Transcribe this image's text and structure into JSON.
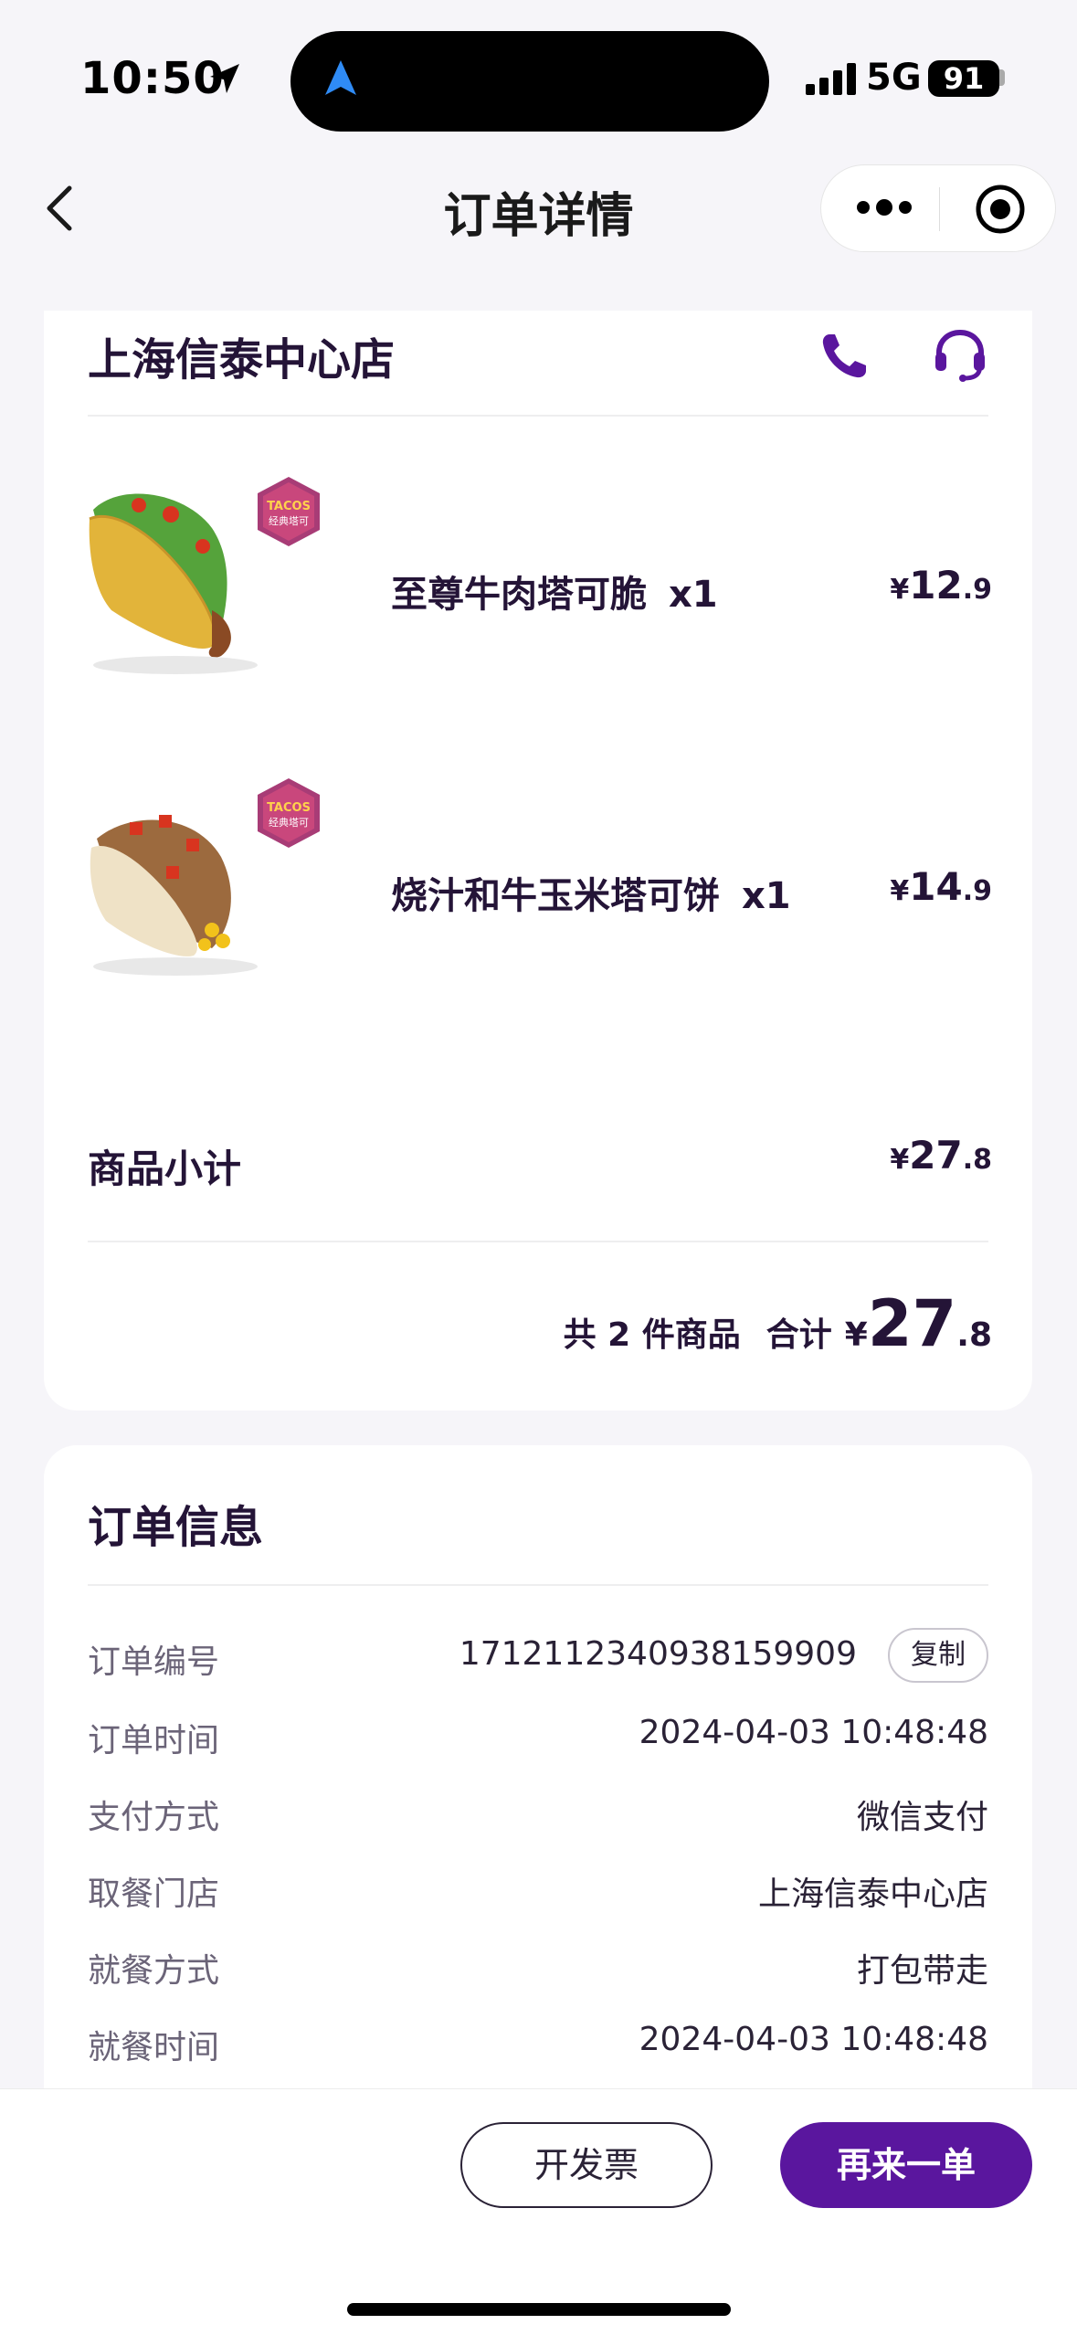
{
  "status_bar": {
    "time": "10:50",
    "network": "5G",
    "battery": "91"
  },
  "nav": {
    "title": "订单详情"
  },
  "store": {
    "name": "上海信泰中心店",
    "items": [
      {
        "name": "至尊牛肉塔可脆",
        "qty": "x1",
        "price_symbol": "¥",
        "price_int": "12",
        "price_dec": ".9",
        "badge_top": "TACOS",
        "badge_bottom": "经典塔可"
      },
      {
        "name": "烧汁和牛玉米塔可饼",
        "qty": "x1",
        "price_symbol": "¥",
        "price_int": "14",
        "price_dec": ".9",
        "badge_top": "TACOS",
        "badge_bottom": "经典塔可"
      }
    ],
    "subtotal_label": "商品小计",
    "subtotal": {
      "symbol": "¥",
      "int": "27",
      "dec": ".8"
    },
    "count_text": "共 2 件商品",
    "total_label": "合计",
    "total": {
      "symbol": "¥",
      "int": "27",
      "dec": ".8"
    }
  },
  "order_info": {
    "title": "订单信息",
    "copy_label": "复制",
    "rows": [
      {
        "label": "订单编号",
        "value": "1712112340938159909"
      },
      {
        "label": "订单时间",
        "value": "2024-04-03 10:48:48"
      },
      {
        "label": "支付方式",
        "value": "微信支付"
      },
      {
        "label": "取餐门店",
        "value": "上海信泰中心店"
      },
      {
        "label": "就餐方式",
        "value": "打包带走"
      },
      {
        "label": "就餐时间",
        "value": "2024-04-03 10:48:48"
      }
    ]
  },
  "actions": {
    "invoice": "开发票",
    "reorder": "再来一单"
  },
  "colors": {
    "brand_purple": "#5a169e",
    "text_dark": "#241437",
    "background": "#f6f5f9"
  }
}
